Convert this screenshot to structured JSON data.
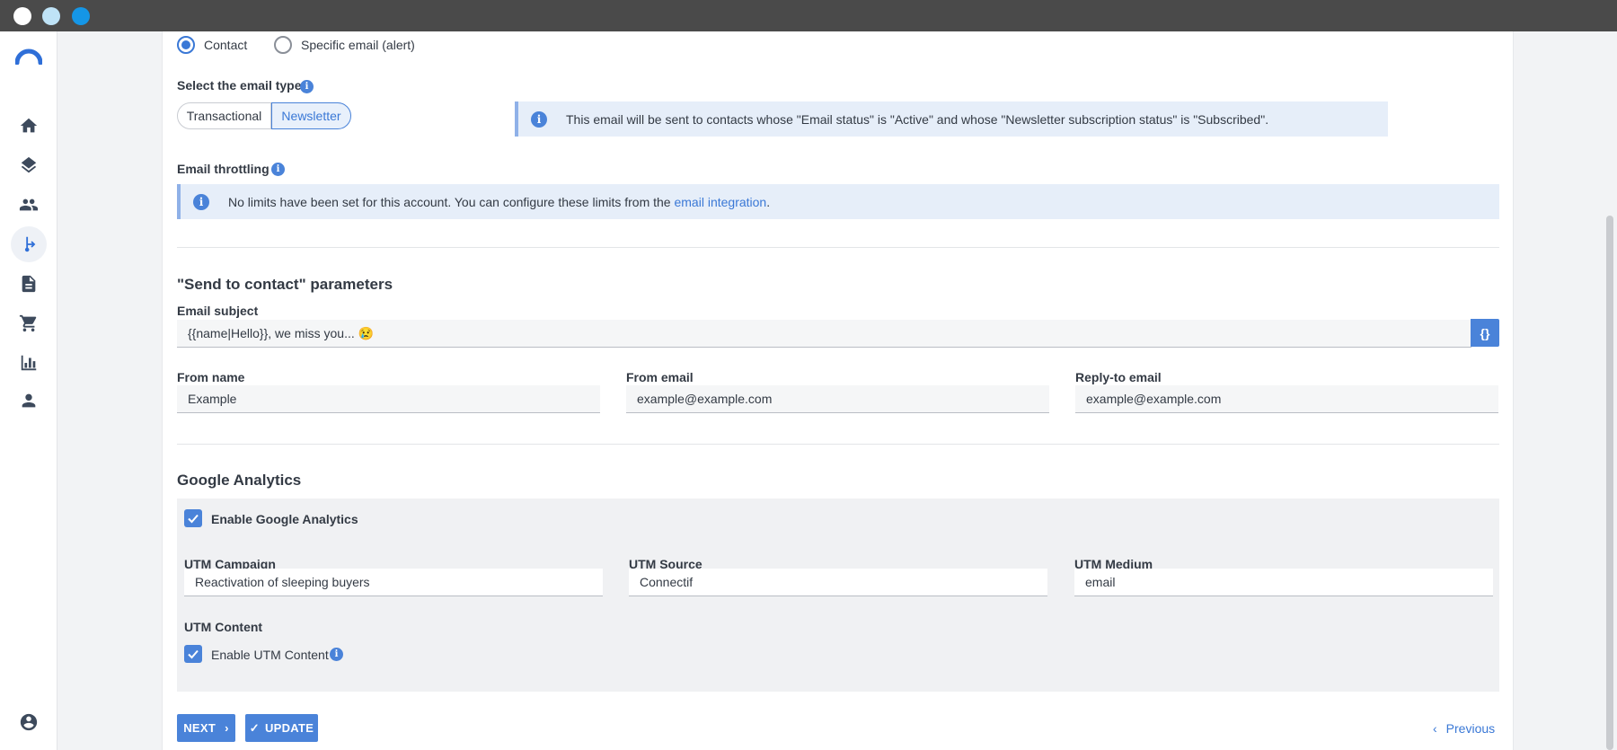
{
  "recipient": {
    "options": [
      {
        "label": "Contact",
        "selected": true
      },
      {
        "label": "Specific email (alert)",
        "selected": false
      }
    ]
  },
  "email_type": {
    "label": "Select the email type",
    "options": [
      "Transactional",
      "Newsletter"
    ],
    "selected": "Newsletter",
    "notice": "This email will be sent to contacts whose \"Email status\" is \"Active\" and whose \"Newsletter subscription status\" is \"Subscribed\"."
  },
  "throttling": {
    "label": "Email throttling",
    "notice_text": "No limits have been set for this account. You can configure these limits from the",
    "notice_link": "email integration",
    "notice_end": "."
  },
  "send_params": {
    "title": "\"Send to contact\" parameters",
    "subject_label": "Email subject",
    "subject_value": "{{name|Hello}}, we miss you... 😢",
    "braces_label": "{}",
    "from_name_label": "From name",
    "from_name_value": "Example",
    "from_email_label": "From email",
    "from_email_value": "example@example.com",
    "reply_to_label": "Reply-to email",
    "reply_to_value": "example@example.com"
  },
  "google_analytics": {
    "title": "Google Analytics",
    "enable_label": "Enable Google Analytics",
    "enabled": true,
    "utm_campaign_label": "UTM Campaign",
    "utm_campaign_value": "Reactivation of sleeping buyers",
    "utm_source_label": "UTM Source",
    "utm_source_value": "Connectif",
    "utm_medium_label": "UTM Medium",
    "utm_medium_value": "email",
    "utm_content_label": "UTM Content",
    "utm_content_enable_label": "Enable UTM Content",
    "utm_content_enabled": true
  },
  "footer": {
    "next_label": "NEXT",
    "update_label": "UPDATE",
    "previous_label": "Previous"
  },
  "sidebar": {
    "items": [
      "home-icon",
      "layers-icon",
      "contacts-icon",
      "workflow-icon",
      "document-icon",
      "cart-icon",
      "bar-chart-icon",
      "user-icon"
    ],
    "active": "workflow-icon",
    "bottom": "account-circle-icon"
  },
  "colors": {
    "accent": "#4a83d9",
    "notice_bg": "#e6eef9",
    "titlebar": "#4a4a4a"
  }
}
